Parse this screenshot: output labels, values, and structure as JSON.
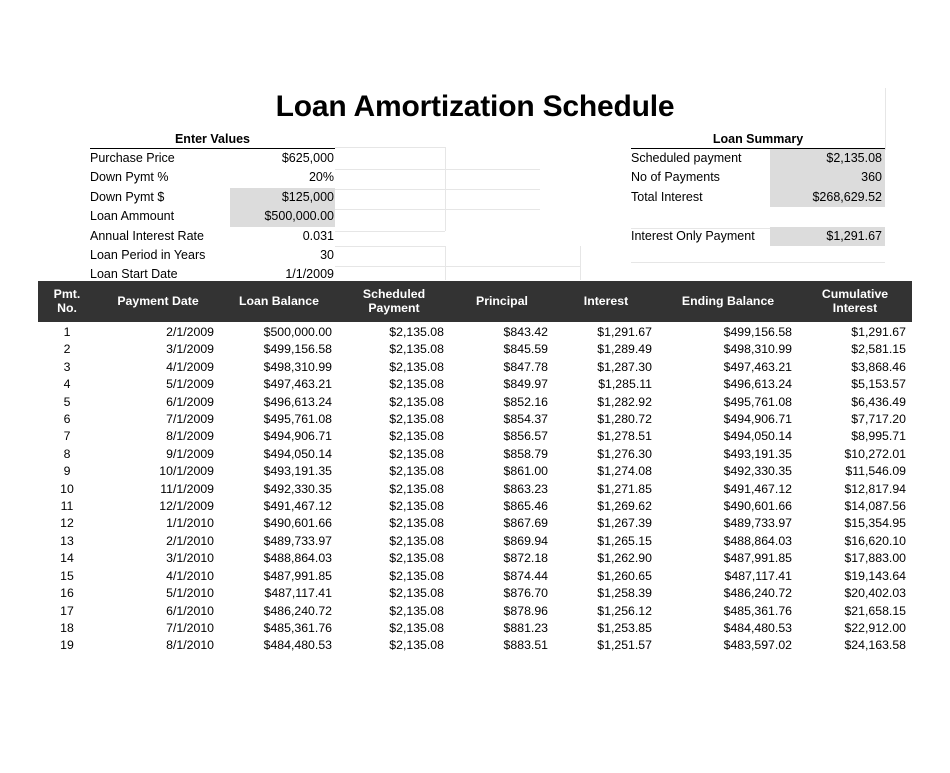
{
  "title": "Loan Amortization Schedule",
  "enter_values": {
    "heading": "Enter Values",
    "rows": [
      {
        "label": "Purchase Price",
        "value": "$625,000",
        "shaded": false
      },
      {
        "label": "Down Pymt %",
        "value": "20%",
        "shaded": false
      },
      {
        "label": "Down Pymt $",
        "value": "$125,000",
        "shaded": true
      },
      {
        "label": "Loan Ammount",
        "value": "$500,000.00",
        "shaded": true
      },
      {
        "label": "Annual Interest Rate",
        "value": "0.031",
        "shaded": false
      },
      {
        "label": "Loan Period in Years",
        "value": "30",
        "shaded": false
      },
      {
        "label": "Loan Start Date",
        "value": "1/1/2009",
        "shaded": false
      }
    ]
  },
  "loan_summary": {
    "heading": "Loan Summary",
    "rows": [
      {
        "label": "Scheduled payment",
        "value": "$2,135.08",
        "shaded": true
      },
      {
        "label": "No of Payments",
        "value": "360",
        "shaded": true
      },
      {
        "label": "Total Interest",
        "value": "$268,629.52",
        "shaded": true
      }
    ],
    "interest_only": {
      "label": "Interest Only Payment",
      "value": "$1,291.67",
      "shaded": true
    }
  },
  "table": {
    "columns": [
      "Pmt. No.",
      "Payment Date",
      "Loan Balance",
      "Scheduled Payment",
      "Principal",
      "Interest",
      "Ending Balance",
      "Cumulative Interest"
    ],
    "column_lines": [
      [
        "Pmt.",
        "No."
      ],
      [
        "Payment Date"
      ],
      [
        "Loan Balance"
      ],
      [
        "Scheduled",
        "Payment"
      ],
      [
        "Principal"
      ],
      [
        "Interest"
      ],
      [
        "Ending Balance"
      ],
      [
        "Cumulative",
        "Interest"
      ]
    ],
    "rows": [
      [
        "1",
        "2/1/2009",
        "$500,000.00",
        "$2,135.08",
        "$843.42",
        "$1,291.67",
        "$499,156.58",
        "$1,291.67"
      ],
      [
        "2",
        "3/1/2009",
        "$499,156.58",
        "$2,135.08",
        "$845.59",
        "$1,289.49",
        "$498,310.99",
        "$2,581.15"
      ],
      [
        "3",
        "4/1/2009",
        "$498,310.99",
        "$2,135.08",
        "$847.78",
        "$1,287.30",
        "$497,463.21",
        "$3,868.46"
      ],
      [
        "4",
        "5/1/2009",
        "$497,463.21",
        "$2,135.08",
        "$849.97",
        "$1,285.11",
        "$496,613.24",
        "$5,153.57"
      ],
      [
        "5",
        "6/1/2009",
        "$496,613.24",
        "$2,135.08",
        "$852.16",
        "$1,282.92",
        "$495,761.08",
        "$6,436.49"
      ],
      [
        "6",
        "7/1/2009",
        "$495,761.08",
        "$2,135.08",
        "$854.37",
        "$1,280.72",
        "$494,906.71",
        "$7,717.20"
      ],
      [
        "7",
        "8/1/2009",
        "$494,906.71",
        "$2,135.08",
        "$856.57",
        "$1,278.51",
        "$494,050.14",
        "$8,995.71"
      ],
      [
        "8",
        "9/1/2009",
        "$494,050.14",
        "$2,135.08",
        "$858.79",
        "$1,276.30",
        "$493,191.35",
        "$10,272.01"
      ],
      [
        "9",
        "10/1/2009",
        "$493,191.35",
        "$2,135.08",
        "$861.00",
        "$1,274.08",
        "$492,330.35",
        "$11,546.09"
      ],
      [
        "10",
        "11/1/2009",
        "$492,330.35",
        "$2,135.08",
        "$863.23",
        "$1,271.85",
        "$491,467.12",
        "$12,817.94"
      ],
      [
        "11",
        "12/1/2009",
        "$491,467.12",
        "$2,135.08",
        "$865.46",
        "$1,269.62",
        "$490,601.66",
        "$14,087.56"
      ],
      [
        "12",
        "1/1/2010",
        "$490,601.66",
        "$2,135.08",
        "$867.69",
        "$1,267.39",
        "$489,733.97",
        "$15,354.95"
      ],
      [
        "13",
        "2/1/2010",
        "$489,733.97",
        "$2,135.08",
        "$869.94",
        "$1,265.15",
        "$488,864.03",
        "$16,620.10"
      ],
      [
        "14",
        "3/1/2010",
        "$488,864.03",
        "$2,135.08",
        "$872.18",
        "$1,262.90",
        "$487,991.85",
        "$17,883.00"
      ],
      [
        "15",
        "4/1/2010",
        "$487,991.85",
        "$2,135.08",
        "$874.44",
        "$1,260.65",
        "$487,117.41",
        "$19,143.64"
      ],
      [
        "16",
        "5/1/2010",
        "$487,117.41",
        "$2,135.08",
        "$876.70",
        "$1,258.39",
        "$486,240.72",
        "$20,402.03"
      ],
      [
        "17",
        "6/1/2010",
        "$486,240.72",
        "$2,135.08",
        "$878.96",
        "$1,256.12",
        "$485,361.76",
        "$21,658.15"
      ],
      [
        "18",
        "7/1/2010",
        "$485,361.76",
        "$2,135.08",
        "$881.23",
        "$1,253.85",
        "$484,480.53",
        "$22,912.00"
      ],
      [
        "19",
        "8/1/2010",
        "$484,480.53",
        "$2,135.08",
        "$883.51",
        "$1,251.57",
        "$483,597.02",
        "$24,163.58"
      ]
    ]
  },
  "colors": {
    "header_bg": "#333333",
    "header_text": "#ffffff",
    "shaded_cell": "#dcdcdc",
    "gridline": "#e6e6e6",
    "text": "#000000"
  }
}
